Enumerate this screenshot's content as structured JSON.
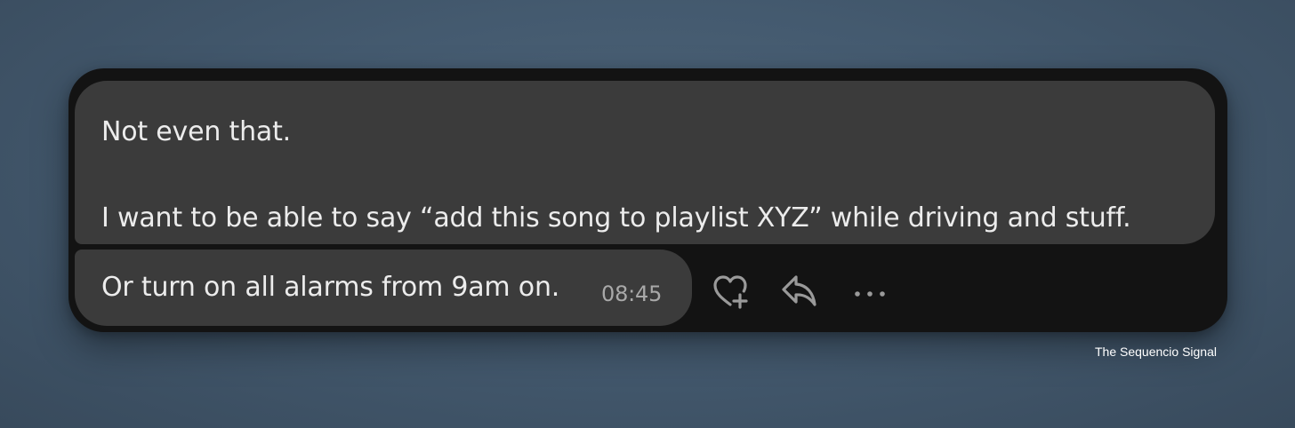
{
  "messages": [
    {
      "lines": [
        "Not even that.",
        "I want to be able to say “add this song to playlist XYZ” while driving and stuff."
      ]
    },
    {
      "lines": [
        "Or turn on all alarms from 9am on."
      ],
      "time": "08:45"
    }
  ],
  "actions": {
    "react_icon": "heart-plus-icon",
    "reply_icon": "reply-icon",
    "more_icon": "more-horizontal-icon"
  },
  "credit": "The Sequencio Signal",
  "colors": {
    "panel": "#131313",
    "bubble": "#3b3b3b",
    "text": "#ececec",
    "muted": "#a9a9a9",
    "icon": "#9a9a9a"
  }
}
